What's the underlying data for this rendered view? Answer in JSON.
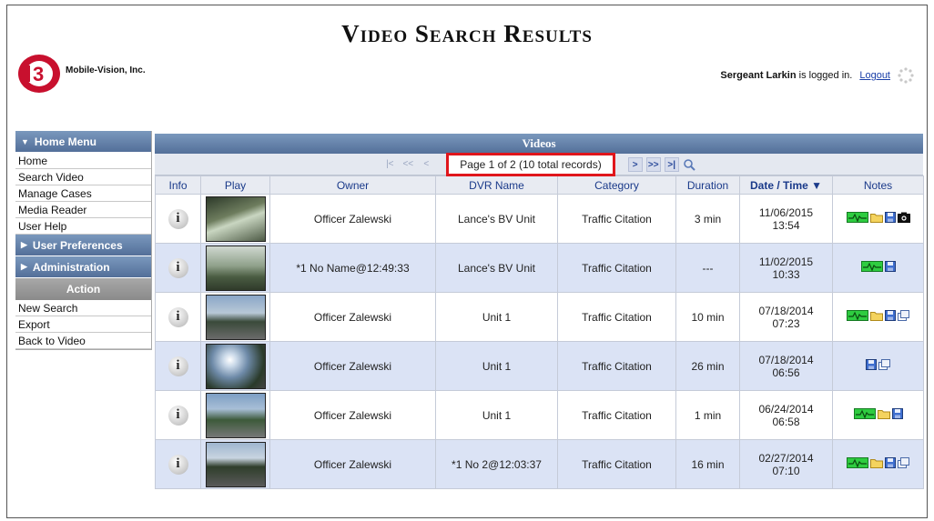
{
  "header": {
    "title": "Video Search Results",
    "brand": "Mobile-Vision, Inc.",
    "user_name": "Sergeant Larkin",
    "logged_in_text": "is logged in.",
    "logout_label": "Logout"
  },
  "sidebar": {
    "home_menu": "Home Menu",
    "home_items": [
      "Home",
      "Search Video",
      "Manage Cases",
      "Media Reader",
      "User Help"
    ],
    "user_prefs": "User Preferences",
    "administration": "Administration",
    "action": "Action",
    "action_items": [
      "New Search",
      "Export",
      "Back to Video"
    ]
  },
  "videos": {
    "title": "Videos",
    "page_info": "Page 1 of 2 (10 total records)",
    "pager": {
      "first": "|<",
      "prev_many": "<<",
      "prev": "<",
      "next": ">",
      "next_many": ">>",
      "last": ">|"
    },
    "columns": [
      "Info",
      "Play",
      "Owner",
      "DVR Name",
      "Category",
      "Duration",
      "Date / Time ▼",
      "Notes"
    ],
    "rows": [
      {
        "owner": "Officer Zalewski",
        "dvr": "Lance's BV Unit",
        "category": "Traffic Citation",
        "duration": "3 min",
        "date": "11/06/2015",
        "time": "13:54",
        "notes": [
          "gps",
          "folder",
          "disk",
          "camera"
        ]
      },
      {
        "owner": "*1 No Name@12:49:33",
        "dvr": "Lance's BV Unit",
        "category": "Traffic Citation",
        "duration": "---",
        "date": "11/02/2015",
        "time": "10:33",
        "notes": [
          "gps",
          "disk"
        ]
      },
      {
        "owner": "Officer Zalewski",
        "dvr": "Unit 1",
        "category": "Traffic Citation",
        "duration": "10 min",
        "date": "07/18/2014",
        "time": "07:23",
        "notes": [
          "gps",
          "folder",
          "disk",
          "copy"
        ]
      },
      {
        "owner": "Officer Zalewski",
        "dvr": "Unit 1",
        "category": "Traffic Citation",
        "duration": "26 min",
        "date": "07/18/2014",
        "time": "06:56",
        "notes": [
          "disk",
          "copy"
        ]
      },
      {
        "owner": "Officer Zalewski",
        "dvr": "Unit 1",
        "category": "Traffic Citation",
        "duration": "1 min",
        "date": "06/24/2014",
        "time": "06:58",
        "notes": [
          "gps",
          "folder",
          "disk"
        ]
      },
      {
        "owner": "Officer Zalewski",
        "dvr": "*1 No 2@12:03:37",
        "category": "Traffic Citation",
        "duration": "16 min",
        "date": "02/27/2014",
        "time": "07:10",
        "notes": [
          "gps",
          "folder",
          "disk",
          "copy"
        ]
      }
    ]
  },
  "colors": {
    "menu_header": "#6482ab",
    "row_alt": "#dbe3f5",
    "highlight_box": "#e0161c",
    "header_text": "#1a3a8a"
  }
}
